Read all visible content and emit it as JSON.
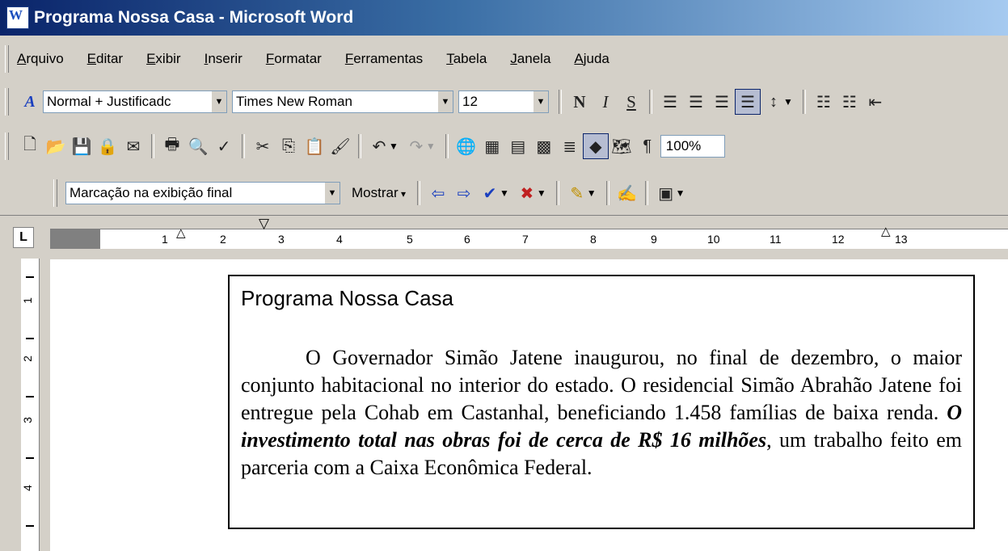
{
  "window": {
    "title": "Programa Nossa Casa - Microsoft Word"
  },
  "menu": [
    "Arquivo",
    "Editar",
    "Exibir",
    "Inserir",
    "Formatar",
    "Ferramentas",
    "Tabela",
    "Janela",
    "Ajuda"
  ],
  "format_toolbar": {
    "style": "Normal + Justificadc",
    "font": "Times New Roman",
    "size": "12",
    "bold": "N",
    "italic": "I",
    "underline": "S"
  },
  "standard_toolbar": {
    "zoom": "100%"
  },
  "review_toolbar": {
    "markup_view": "Marcação na exibição final",
    "show_label": "Mostrar"
  },
  "ruler": {
    "labels": [
      "1",
      "2",
      "3",
      "4",
      "5",
      "6",
      "7",
      "8",
      "9",
      "10",
      "11",
      "12",
      "13"
    ]
  },
  "vruler": {
    "labels": [
      "1",
      "2",
      "3",
      "4"
    ]
  },
  "document": {
    "title": "Programa Nossa Casa",
    "para_before": "O Governador Simão Jatene inaugurou, no final de dezembro, o maior conjunto habitacional no interior do estado. O residencial Simão Abrahão Jatene foi entregue pela Cohab em Castanhal, beneficiando 1.458 famílias de baixa renda. ",
    "para_bold": "O investimento total nas obras foi de cerca de R$ 16 milhões",
    "para_after": ", um trabalho feito em parceria com a Caixa Econômica Federal."
  }
}
